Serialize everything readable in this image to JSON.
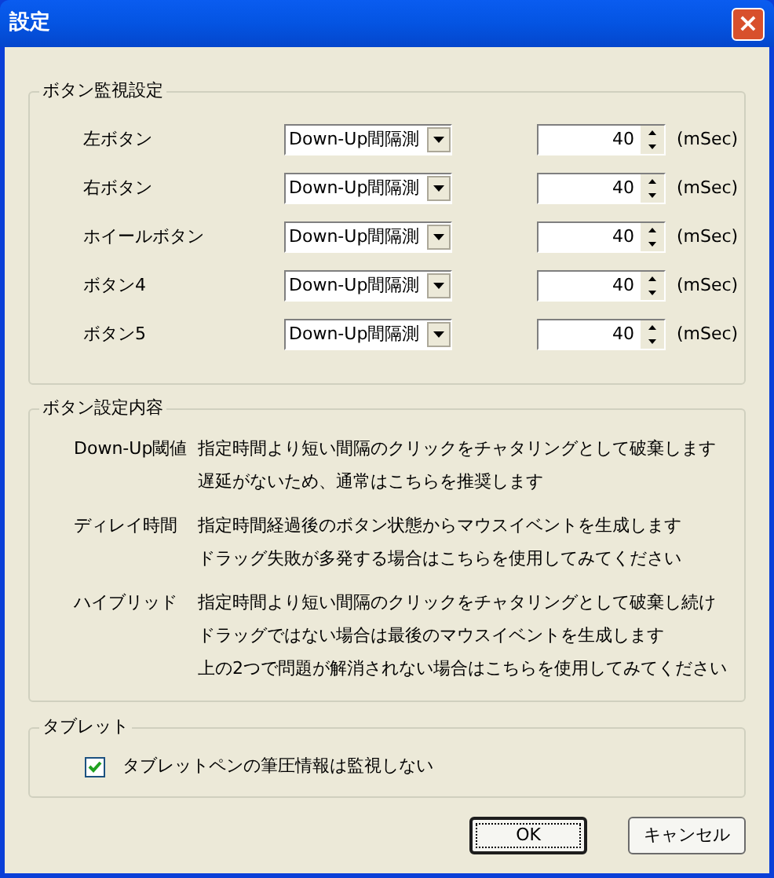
{
  "window": {
    "title": "設定",
    "close": "×"
  },
  "monitor_group": {
    "title": "ボタン監視設定",
    "rows": [
      {
        "label": "左ボタン",
        "mode": "Down-Up間隔測",
        "value": "40",
        "unit": "(mSec)"
      },
      {
        "label": "右ボタン",
        "mode": "Down-Up間隔測",
        "value": "40",
        "unit": "(mSec)"
      },
      {
        "label": "ホイールボタン",
        "mode": "Down-Up間隔測",
        "value": "40",
        "unit": "(mSec)"
      },
      {
        "label": "ボタン4",
        "mode": "Down-Up間隔測",
        "value": "40",
        "unit": "(mSec)"
      },
      {
        "label": "ボタン5",
        "mode": "Down-Up間隔測",
        "value": "40",
        "unit": "(mSec)"
      }
    ]
  },
  "description_group": {
    "title": "ボタン設定内容",
    "entries": [
      {
        "term": "Down-Up閾値",
        "lines": [
          "指定時間より短い間隔のクリックをチャタリングとして破棄します",
          "遅延がないため、通常はこちらを推奨します"
        ]
      },
      {
        "term": "ディレイ時間",
        "lines": [
          "指定時間経過後のボタン状態からマウスイベントを生成します",
          "ドラッグ失敗が多発する場合はこちらを使用してみてください"
        ]
      },
      {
        "term": "ハイブリッド",
        "lines": [
          "指定時間より短い間隔のクリックをチャタリングとして破棄し続け",
          "ドラッグではない場合は最後のマウスイベントを生成します",
          "上の2つで問題が解消されない場合はこちらを使用してみてください"
        ]
      }
    ]
  },
  "tablet_group": {
    "title": "タブレット",
    "checkbox": {
      "label": "タブレットペンの筆圧情報は監視しない",
      "checked": true
    }
  },
  "buttons": [
    {
      "label": "OK",
      "default": true
    },
    {
      "label": "キャンセル",
      "default": false
    }
  ]
}
